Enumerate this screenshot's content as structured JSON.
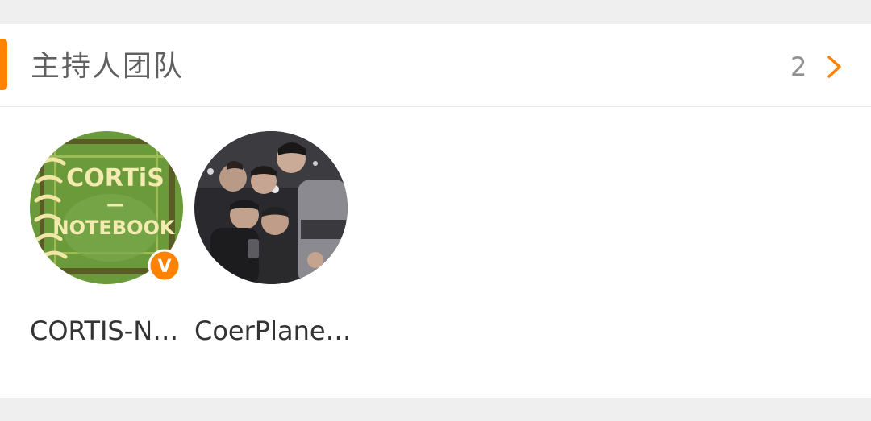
{
  "section": {
    "title": "主持人团队",
    "count": "2",
    "accent_color": "#ff8200",
    "more_icon": "chevron-right-icon"
  },
  "members": [
    {
      "name": "CORTIS-N…",
      "avatar_text": [
        "CORTiS",
        "—",
        "NOTEBOOK"
      ],
      "verified": true,
      "verified_badge_letter": "V",
      "verified_color": "#ff8200"
    },
    {
      "name": "CoerPlane…",
      "verified": false
    }
  ]
}
